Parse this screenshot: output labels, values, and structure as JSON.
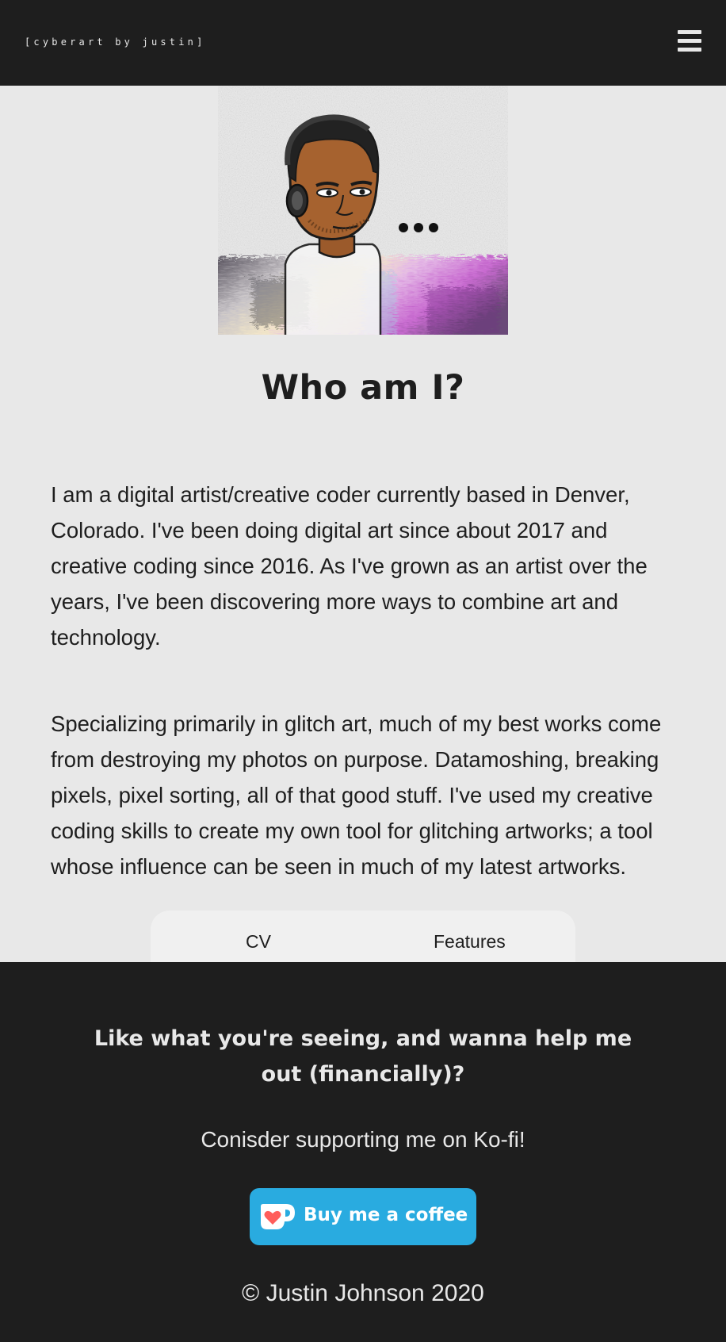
{
  "header": {
    "brand": "[cyberart by justin]",
    "menu_icon": "hamburger-menu-icon"
  },
  "avatar": {
    "icon": "bitmoji-avatar-image",
    "ellipsis": "..."
  },
  "main": {
    "title": "Who am I?",
    "paragraphs": [
      "I am a digital artist/creative coder currently based in Denver, Colorado. I've been doing digital art since about 2017 and creative coding since 2016. As I've grown as an artist over the years, I've been discovering more ways to combine art and technology.",
      "Specializing primarily in glitch art, much of my best works come from destroying my photos on purpose. Datamoshing, breaking pixels, pixel sorting, all of that good stuff. I've used my creative coding skills to create my own tool for glitching artworks; a tool whose influence can be seen in much of my latest artworks."
    ],
    "tabs": [
      {
        "label": "CV"
      },
      {
        "label": "Features"
      }
    ]
  },
  "footer": {
    "heading": "Like what you're seeing, and wanna help me out (financially)?",
    "subtext": "Conisder supporting me on Ko-fi!",
    "kofi_button": {
      "label": "Buy me a coffee",
      "icon": "kofi-cup-heart-icon"
    },
    "copyright": "© Justin Johnson 2020"
  },
  "colors": {
    "background": "#e8e8e8",
    "dark": "#1e1e1e",
    "kofi_blue": "#29abe0",
    "heart_red": "#ff5e5b"
  }
}
